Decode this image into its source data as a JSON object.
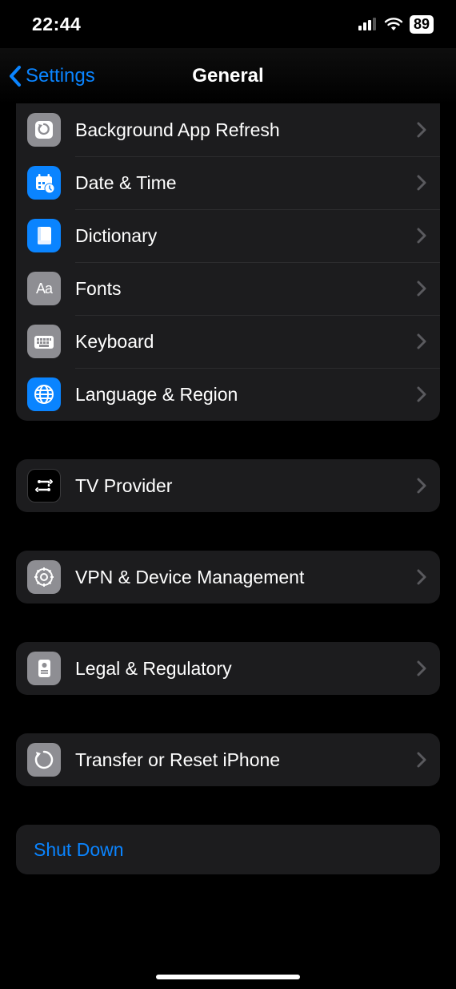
{
  "status": {
    "time": "22:44",
    "battery": "89"
  },
  "nav": {
    "back": "Settings",
    "title": "General"
  },
  "groups": [
    {
      "id": "g1",
      "partialTop": true,
      "rows": [
        {
          "label": "Background App Refresh",
          "iconBg": "gray",
          "iconId": "refresh-icon"
        },
        {
          "label": "Date & Time",
          "iconBg": "blue",
          "iconId": "calendar-clock-icon"
        },
        {
          "label": "Dictionary",
          "iconBg": "blue",
          "iconId": "book-icon"
        },
        {
          "label": "Fonts",
          "iconBg": "gray",
          "iconId": "fonts-icon"
        },
        {
          "label": "Keyboard",
          "iconBg": "gray",
          "iconId": "keyboard-icon"
        },
        {
          "label": "Language & Region",
          "iconBg": "blue",
          "iconId": "globe-icon"
        }
      ]
    },
    {
      "id": "g2",
      "rows": [
        {
          "label": "TV Provider",
          "iconBg": "black",
          "iconId": "tv-provider-icon"
        }
      ]
    },
    {
      "id": "g3",
      "rows": [
        {
          "label": "VPN & Device Management",
          "iconBg": "gray",
          "iconId": "gear-badge-icon"
        }
      ]
    },
    {
      "id": "g4",
      "rows": [
        {
          "label": "Legal & Regulatory",
          "iconBg": "gray",
          "iconId": "document-seal-icon"
        }
      ]
    },
    {
      "id": "g5",
      "rows": [
        {
          "label": "Transfer or Reset iPhone",
          "iconBg": "gray",
          "iconId": "reset-icon"
        }
      ]
    }
  ],
  "shutdown": {
    "label": "Shut Down"
  },
  "colors": {
    "accent": "#0a84ff",
    "groupBg": "#1c1c1e",
    "iconGray": "#8e8e93"
  }
}
